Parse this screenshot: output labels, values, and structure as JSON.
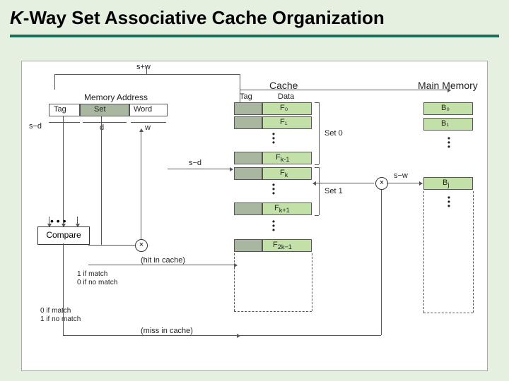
{
  "title": {
    "k": "K",
    "rest": "-Way Set Associative Cache Organization"
  },
  "labels": {
    "sw": "s+w",
    "memaddr": "Memory Address",
    "tag": "Tag",
    "set": "Set",
    "word": "Word",
    "sd": "s−d",
    "d": "d",
    "w": "w",
    "cache": "Cache",
    "cacheTag": "Tag",
    "cacheData": "Data",
    "set0": "Set 0",
    "set1": "Set 1",
    "mainmem": "Main Memory",
    "compare": "Compare",
    "sd2": "s−d",
    "sw2": "s−w",
    "hit": "(hit in cache)",
    "miss": "(miss in cache)",
    "m1": "1 if match",
    "m0": "0 if no match",
    "n1": "0 if match",
    "n0": "1 if no match",
    "dots3": "• • •",
    "x": "×"
  },
  "cacheLines": [
    "F₀",
    "F₁",
    "F_{k-1}",
    "F_k",
    "F_{k+1}",
    "F_{2k−1}"
  ],
  "memLines": [
    "B₀",
    "B₁",
    "B_j"
  ]
}
